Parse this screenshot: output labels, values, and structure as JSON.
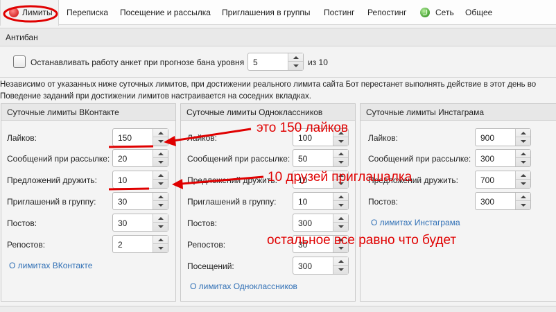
{
  "tabs": [
    {
      "label": "Лимиты",
      "icon": "stop-icon",
      "active": true
    },
    {
      "label": "Переписка"
    },
    {
      "label": "Посещение и рассылка"
    },
    {
      "label": "Приглашения в группы"
    },
    {
      "label": "Постинг"
    },
    {
      "label": "Репостинг"
    },
    {
      "label": "Сеть",
      "icon": "network-icon"
    },
    {
      "label": "Общее"
    }
  ],
  "antiban": {
    "title": "Антибан",
    "checkbox_label": "Останавливать работу анкет при прогнозе бана уровня",
    "checked": false,
    "level_value": "5",
    "of_label": "из 10"
  },
  "info": {
    "line1": "Независимо от указанных ниже суточных лимитов, при достижении реального лимита сайта Бот перестанет выполнять действие в этот день во",
    "line2": "Поведение заданий при достижении лимитов настраивается на соседних вкладках."
  },
  "panels": {
    "vk": {
      "title": "Суточные лимиты ВКонтакте",
      "rows": [
        {
          "label": "Лайков:",
          "value": "150"
        },
        {
          "label": "Сообщений при рассылке:",
          "value": "20"
        },
        {
          "label": "Предложений дружить:",
          "value": "10"
        },
        {
          "label": "Приглашений в группу:",
          "value": "30"
        },
        {
          "label": "Постов:",
          "value": "30"
        },
        {
          "label": "Репостов:",
          "value": "2"
        }
      ],
      "link": "О лимитах ВКонтакте"
    },
    "ok": {
      "title": "Суточные лимиты Одноклассников",
      "rows": [
        {
          "label": "Лайков:",
          "value": "100"
        },
        {
          "label": "Сообщений при рассылке:",
          "value": "50"
        },
        {
          "label": "Предложений дружить:",
          "value": "10"
        },
        {
          "label": "Приглашений в группу:",
          "value": "10"
        },
        {
          "label": "Постов:",
          "value": "300"
        },
        {
          "label": "Репостов:",
          "value": "30"
        },
        {
          "label": "Посещений:",
          "value": "300"
        }
      ],
      "link": "О лимитах Одноклассников"
    },
    "ig": {
      "title": "Суточные лимиты Инстаграма",
      "rows": [
        {
          "label": "Лайков:",
          "value": "900"
        },
        {
          "label": "Сообщений при рассылке:",
          "value": "300"
        },
        {
          "label": "Предложений дружить:",
          "value": "700"
        },
        {
          "label": "Постов:",
          "value": "300"
        }
      ],
      "link": "О лимитах Инстаграма"
    }
  },
  "annotations": {
    "likes_note": "это 150 лайков",
    "friends_note": "10 друзей приглашалка",
    "rest_note": "остальное  все  равно что будет",
    "color": "#e00000"
  }
}
